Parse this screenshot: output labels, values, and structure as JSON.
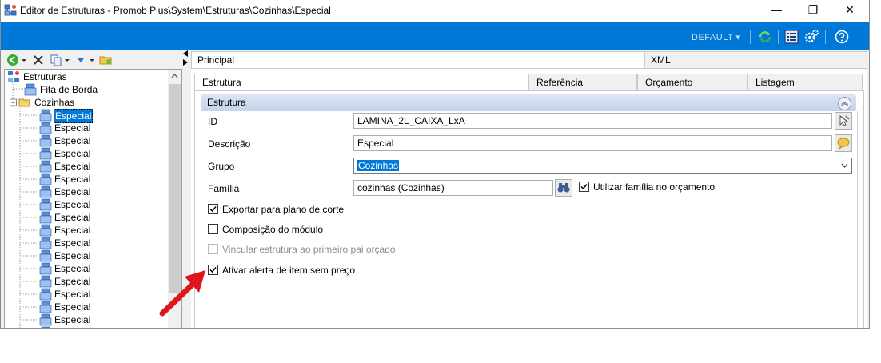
{
  "window": {
    "title": "Editor de Estruturas - Promob Plus\\System\\Estruturas\\Cozinhas\\Especial",
    "minimize": "—",
    "restore": "❐",
    "close": "✕"
  },
  "blue_toolbar": {
    "profile_label": "DEFAULT ▾",
    "accent": "#0078d7"
  },
  "toolbar_icons": [
    "back-circle-icon",
    "delete-icon",
    "copy-icon",
    "move-down-icon",
    "folder-icon"
  ],
  "tree": {
    "root": "Estruturas",
    "children": [
      {
        "label": "Fita de Borda"
      },
      {
        "label": "Cozinhas"
      }
    ],
    "items": [
      "Especial",
      "Especial",
      "Especial",
      "Especial",
      "Especial",
      "Especial",
      "Especial",
      "Especial",
      "Especial",
      "Especial",
      "Especial",
      "Especial",
      "Especial",
      "Especial",
      "Especial",
      "Especial",
      "Especial",
      "Especial"
    ],
    "selected_index": 0
  },
  "tabs": {
    "main": [
      "Principal",
      "XML"
    ],
    "sub": [
      "Estrutura",
      "Referência",
      "Orçamento",
      "Listagem"
    ]
  },
  "group": {
    "title": "Estrutura"
  },
  "form": {
    "id_label": "ID",
    "id_value": "LAMINA_2L_CAIXA_LxA",
    "desc_label": "Descrição",
    "desc_value": "Especial",
    "grupo_label": "Grupo",
    "grupo_value": "Cozinhas",
    "familia_label": "Família",
    "familia_value": "cozinhas (Cozinhas)",
    "usar_familia_label": "Utilizar família no orçamento",
    "exportar_label": "Exportar para plano de corte",
    "composicao_label": "Composição do módulo",
    "vincular_label": "Vincular estrutura ao primeiro pai orçado",
    "alerta_label": "Ativar alerta de item sem preço",
    "checks": {
      "usar_familia": true,
      "exportar": true,
      "composicao": false,
      "vincular": false,
      "alerta": true
    }
  }
}
